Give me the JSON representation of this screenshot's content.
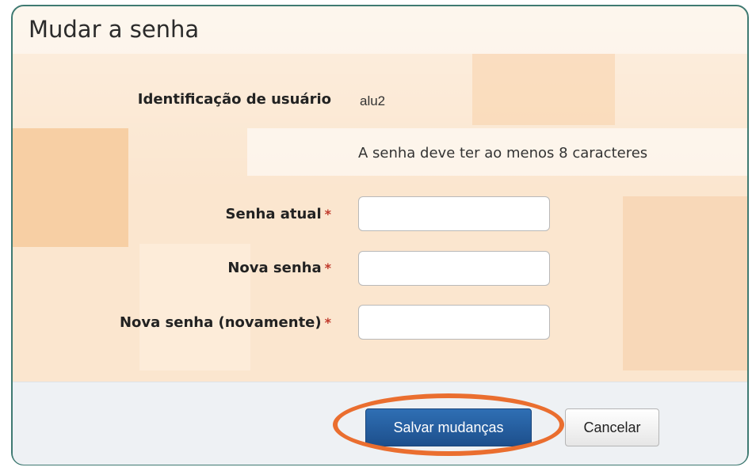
{
  "page": {
    "title": "Mudar a senha"
  },
  "form": {
    "username_label": "Identificação de usuário",
    "username_value": "alu2",
    "password_hint": "A senha deve ter ao menos 8 caracteres",
    "required_mark": "*",
    "fields": [
      {
        "label": "Senha atual",
        "value": ""
      },
      {
        "label": "Nova senha",
        "value": ""
      },
      {
        "label": "Nova senha (novamente)",
        "value": ""
      }
    ]
  },
  "actions": {
    "save_label": "Salvar mudanças",
    "cancel_label": "Cancelar"
  },
  "colors": {
    "accent": "#1d4f8c",
    "required": "#c0392b",
    "highlight_ring": "#ea6e2f",
    "frame_border": "#3f7a72"
  }
}
